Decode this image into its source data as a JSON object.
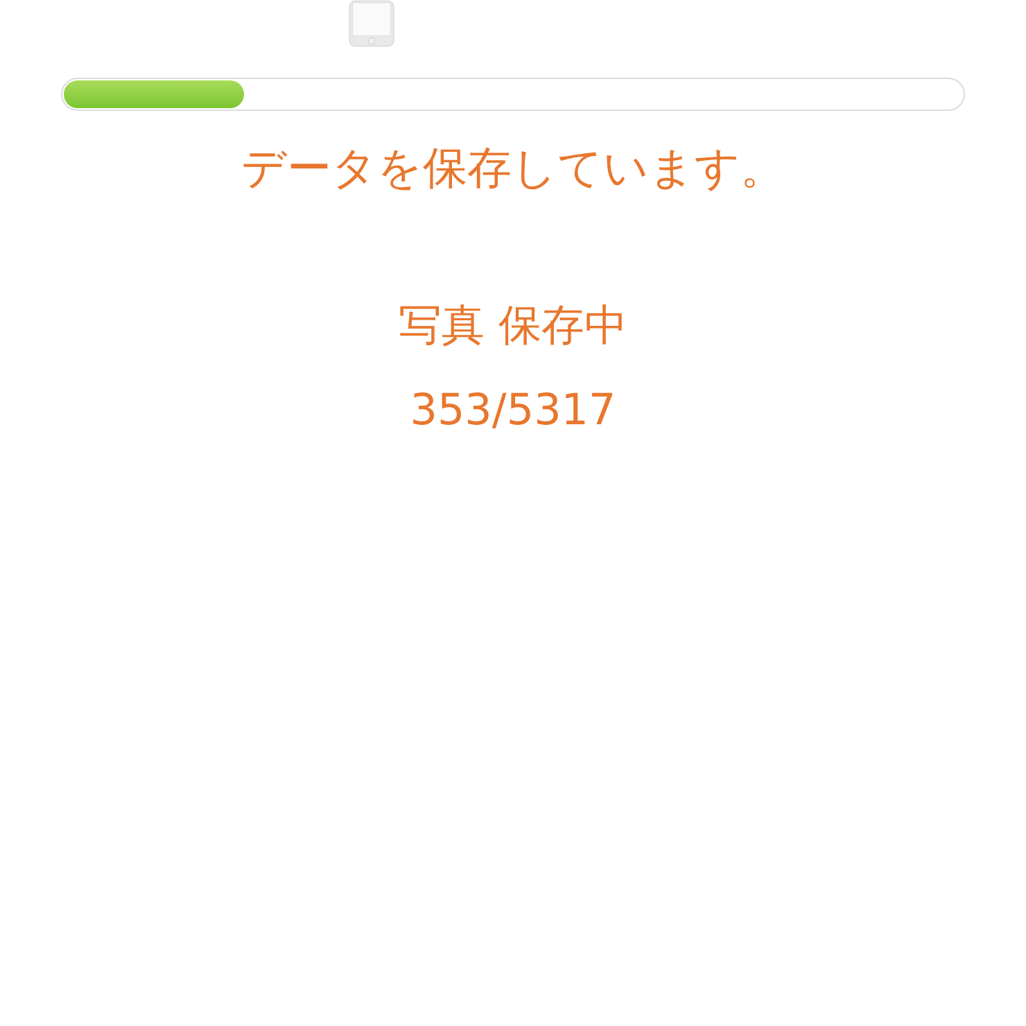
{
  "progress": {
    "level": 0.2
  },
  "message": "データを保存しています。",
  "status_line": "写真 保存中",
  "count": "353/5317"
}
